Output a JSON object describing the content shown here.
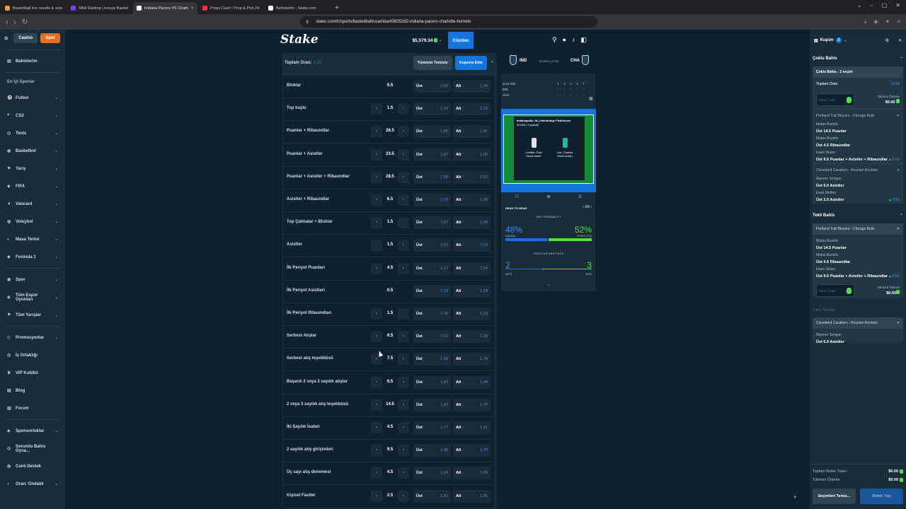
{
  "browser": {
    "tabs": [
      {
        "title": "Basketball live results & schedule | S",
        "fav": "#e8a33a"
      },
      {
        "title": "NBA Starting Lineups Basketball Dai",
        "fav": "#7b3fe4"
      },
      {
        "title": "Indiana Pacers VS Charlotte Hor",
        "fav": "#ffffff"
      },
      {
        "title": "Props.Cash | Prop & Pick Finder",
        "fav": "#e03b3b"
      },
      {
        "title": "Bahislerim - Stake.com",
        "fav": "#ffffff"
      }
    ],
    "close_glyph": "✕",
    "new_tab": "+",
    "url": "stake.com/tr/sports/basketball/usa/nba/43825282-indiana-pacers-charlotte-hornets"
  },
  "sidebar": {
    "casino_label": "Casino",
    "spor_label": "Spor",
    "my_bets": "Bahislerim",
    "top_sports_header": "En İyi Sporlar",
    "sports": [
      {
        "label": "Futbol",
        "icon": "⚽"
      },
      {
        "label": "CS2",
        "icon": "⌖"
      },
      {
        "label": "Tenis",
        "icon": "◎"
      },
      {
        "label": "Basketbol",
        "icon": "◉"
      },
      {
        "label": "Yarış",
        "icon": "⚑"
      },
      {
        "label": "FIFA",
        "icon": "◈"
      },
      {
        "label": "Valorant",
        "icon": "▼"
      },
      {
        "label": "Voleybol",
        "icon": "◍"
      },
      {
        "label": "Masa Tenisi",
        "icon": "◐"
      },
      {
        "label": "Formula 1",
        "icon": "◆"
      }
    ],
    "more": [
      {
        "label": "Spor",
        "icon": "◉"
      },
      {
        "label": "Tüm Espor Oyunları",
        "icon": "◈"
      },
      {
        "label": "Tüm Yarışlar",
        "icon": "⚑"
      }
    ],
    "misc": [
      {
        "label": "Promosyonlar",
        "icon": "◇"
      },
      {
        "label": "İş Ortaklığı",
        "icon": "◎"
      },
      {
        "label": "VIP Kulübü",
        "icon": "♛"
      },
      {
        "label": "Blog",
        "icon": "▤"
      },
      {
        "label": "Forum",
        "icon": "▥"
      }
    ],
    "footer": [
      {
        "label": "Sponsorluklar",
        "icon": "◈"
      },
      {
        "label": "Sorumlu Bahis Oyna...",
        "icon": "◎"
      },
      {
        "label": "Canlı Destek",
        "icon": "◍"
      },
      {
        "label": "Oran: Ondalık",
        "icon": "◐"
      }
    ]
  },
  "header": {
    "logo": "Stake",
    "balance": "$5,579.34",
    "wallet_label": "Cüzdan"
  },
  "market": {
    "total_odds_label": "Toplam Oran:",
    "total_odds_value": "6,20",
    "clear_label": "Tümünü Temizle",
    "add_coupon_label": "Kupona Ekle",
    "over_label": "Üst",
    "under_label": "Alt",
    "rows": [
      {
        "name": "Bloklar",
        "line": "0.5",
        "arrows": false,
        "left_dis": false,
        "right_dis": false,
        "over": "2,90",
        "under": "1,34"
      },
      {
        "name": "Top kaybı",
        "line": "1.5",
        "arrows": true,
        "left_dis": false,
        "right_dis": false,
        "over": "1,63",
        "under": "2,10"
      },
      {
        "name": "Puanlar + Ribaundlar",
        "line": "26.5",
        "arrows": true,
        "left_dis": false,
        "right_dis": false,
        "over": "1,86",
        "under": "1,81"
      },
      {
        "name": "Puanlar + Asistler",
        "line": "23.5",
        "arrows": true,
        "left_dis": false,
        "right_dis": false,
        "over": "1,87",
        "under": "1,80"
      },
      {
        "name": "Puanlar + Asistler + Ribaundlar",
        "line": "28.5",
        "arrows": true,
        "left_dis": false,
        "right_dis": false,
        "over": "1,85",
        "under": "1,82"
      },
      {
        "name": "Asistler + Ribaundlar",
        "line": "6.5",
        "arrows": true,
        "left_dis": false,
        "right_dis": false,
        "over": "1,70",
        "under": "1,99"
      },
      {
        "name": "Top Çalmalar + Bloklar",
        "line": "1.5",
        "arrows": true,
        "left_dis": false,
        "right_dis": true,
        "over": "2,67",
        "under": "1,40"
      },
      {
        "name": "Asistler",
        "line": "1.5",
        "arrows": true,
        "left_dis": true,
        "right_dis": false,
        "over": "1,63",
        "under": "2,10"
      },
      {
        "name": "İlk Periyot Puanları",
        "line": "4.5",
        "arrows": true,
        "left_dis": false,
        "right_dis": false,
        "over": "1,67",
        "under": "2,04"
      },
      {
        "name": "İlk Periyot Asistleri",
        "line": "0.5",
        "arrows": false,
        "left_dis": false,
        "right_dis": false,
        "over": "2,18",
        "under": "1,58"
      },
      {
        "name": "İlk Periyot Ribaundları",
        "line": "1.5",
        "arrows": true,
        "left_dis": false,
        "right_dis": true,
        "over": "2,30",
        "under": "1,53"
      },
      {
        "name": "Serbest Atışlar",
        "line": "6.5",
        "arrows": true,
        "left_dis": false,
        "right_dis": false,
        "over": "2,02",
        "under": "1,68"
      },
      {
        "name": "Serbest atış teşebbüsü",
        "line": "7.5",
        "arrows": true,
        "left_dis": false,
        "right_dis": false,
        "over": "1,89",
        "under": "1,78"
      },
      {
        "name": "Başarılı 2 veya 3 sayılık atışlar",
        "line": "6.5",
        "arrows": true,
        "left_dis": false,
        "right_dis": false,
        "over": "1,83",
        "under": "1,84"
      },
      {
        "name": "2 veya 3 sayılık atış teşebbüsü",
        "line": "14.5",
        "arrows": true,
        "left_dis": false,
        "right_dis": false,
        "over": "1,93",
        "under": "1,75"
      },
      {
        "name": "İki Sayılık İsabet",
        "line": "4.5",
        "arrows": true,
        "left_dis": false,
        "right_dis": false,
        "over": "1,77",
        "under": "1,91"
      },
      {
        "name": "2 sayılık atış girişimleri",
        "line": "9.5",
        "arrows": true,
        "left_dis": false,
        "right_dis": false,
        "over": "1,99",
        "under": "1,70"
      },
      {
        "name": "Üç sayı atış denemesi",
        "line": "4.5",
        "arrows": true,
        "left_dis": false,
        "right_dis": false,
        "over": "1,64",
        "under": "2,09"
      },
      {
        "name": "Kişisel Fauller",
        "line": "2.5",
        "arrows": true,
        "left_dis": false,
        "right_dis": false,
        "over": "1,81",
        "under": "1,86"
      }
    ]
  },
  "scoreboard": {
    "home": "IND",
    "away": "CHA",
    "date": "20 NOV | 07:00",
    "grid_header": [
      "4x12 Min",
      "1",
      "2",
      "3",
      "4",
      "T"
    ],
    "grid_rows": [
      [
        "IND",
        "-",
        "-",
        "-",
        "-",
        "-"
      ],
      [
        "CHA",
        "-",
        "-",
        "-",
        "-",
        "-"
      ]
    ],
    "venue": "Indianapolis, IN | Gainbridge Fieldhouse",
    "capacity": "20,000 | Capacity",
    "home_coach_name": "Carlisle, Rick",
    "away_coach_name": "Lee, Charles",
    "coach_role": "Head coach",
    "h2h_label": "HEAD TO HEAD",
    "h2h_nav": "‹ 1/6 ›",
    "win_prob_label": "WIN PROBABILITY",
    "home_pct": "48%",
    "away_pct": "52%",
    "home_name": "INDIANA",
    "away_name": "CHARLOTTE",
    "home_prob": 0.48,
    "prev_label": "PREVIOUS MEETINGS",
    "home_wins": "2",
    "away_wins": "3",
    "wins_label": "WINS",
    "home_color": "#1475e1",
    "away_color": "#4ee04e"
  },
  "coupon": {
    "title": "Kupon",
    "count": "2",
    "multi_header": "Çoklu Bahis",
    "multi_card_title": "Çoklu Bahis - 2 seçim",
    "total_odds_label": "Toplam Oran",
    "total_odds_value": "19,88",
    "stake_placeholder": "Bahis Tutarı",
    "est_payout_label": "Tahmini Ödeme",
    "zero_amount": "$0.00",
    "legs": [
      {
        "match": "Portland Trail Blazers - Chicago Bulls",
        "selections": [
          {
            "player": "Matas Buzelis",
            "pick": "Üst 14.5 Puanlar",
            "odds": ""
          },
          {
            "player": "Matas Buzelis",
            "pick": "Üst 4.5 Ribaundlar",
            "odds": ""
          },
          {
            "player": "Isaac Okoro",
            "pick": "Üst 9.5 Puanlar + Asistler + Ribaundlar",
            "odds": "5,60"
          }
        ]
      },
      {
        "match": "Cleveland Cavaliers - Houston Rockets",
        "selections": [
          {
            "player": "Alperen Sengun",
            "pick": "Üst 6.5 Asistler",
            "odds": ""
          },
          {
            "player": "Evan Mobley",
            "pick": "Üst 3.5 Asistler",
            "odds": "3,55"
          }
        ]
      }
    ],
    "single_header": "Tekli Bahis",
    "single_card": {
      "match": "Portland Trail Blazers - Chicago Bulls",
      "selections": [
        {
          "player": "Matas Buzelis",
          "pick": "Üst 14.5 Puanlar",
          "odds": ""
        },
        {
          "player": "Matas Buzelis",
          "pick": "Üst 4.5 Ribaundlar",
          "odds": ""
        },
        {
          "player": "Isaac Okoro",
          "pick": "Üst 9.5 Puanlar + Asistler + Ribaundlar",
          "odds": "5,60"
        }
      ]
    },
    "stake_amounts_label": "Tutarı Tekrarla",
    "single_card_2": {
      "match": "Cleveland Cavaliers - Houston Rockets",
      "selections": [
        {
          "player": "Alperen Sengun",
          "pick": "Üst 6.5 Asistler",
          "odds": ""
        },
        {
          "player": "Evan Mobley",
          "pick": "Üst 3.5 Asistler",
          "odds": "3,55"
        }
      ]
    },
    "total_stake_label": "Toplam Bahis Tutarı",
    "total_stake_value": "$0.00",
    "total_payout_label": "Tahmini Ödeme",
    "total_payout_value": "$0.00",
    "clear_selections": "Seçimleri Temiz...",
    "place_bet": "Bahis Yap"
  }
}
